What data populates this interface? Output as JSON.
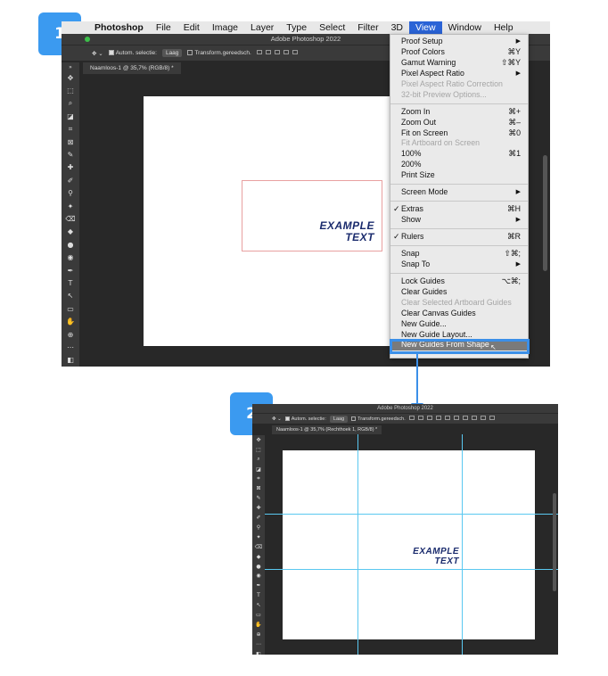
{
  "steps": {
    "one": "1",
    "two": "2"
  },
  "shot1": {
    "menubar": {
      "app": "Photoshop",
      "items": [
        "File",
        "Edit",
        "Image",
        "Layer",
        "Type",
        "Select",
        "Filter",
        "3D",
        "View",
        "Window",
        "Help"
      ],
      "active": "View"
    },
    "window_title": "Adobe Photoshop 2022",
    "options": {
      "autoselect": "Autom. selectie:",
      "layer_select": "Laag",
      "transform": "Transform.gereedsch."
    },
    "doc_tab": "Naamloos-1 @ 35,7% (RGB/8) *",
    "example_text": [
      "EXAMPLE",
      "TEXT"
    ],
    "view_menu": [
      {
        "label": "Proof Setup",
        "submenu": true
      },
      {
        "label": "Proof Colors",
        "shortcut": "⌘Y"
      },
      {
        "label": "Gamut Warning",
        "shortcut": "⇧⌘Y"
      },
      {
        "label": "Pixel Aspect Ratio",
        "submenu": true
      },
      {
        "label": "Pixel Aspect Ratio Correction",
        "disabled": true
      },
      {
        "label": "32-bit Preview Options...",
        "disabled": true
      },
      {
        "separator": true
      },
      {
        "label": "Zoom In",
        "shortcut": "⌘+"
      },
      {
        "label": "Zoom Out",
        "shortcut": "⌘–"
      },
      {
        "label": "Fit on Screen",
        "shortcut": "⌘0"
      },
      {
        "label": "Fit Artboard on Screen",
        "disabled": true
      },
      {
        "label": "100%",
        "shortcut": "⌘1"
      },
      {
        "label": "200%"
      },
      {
        "label": "Print Size"
      },
      {
        "separator": true
      },
      {
        "label": "Screen Mode",
        "submenu": true
      },
      {
        "separator": true
      },
      {
        "label": "Extras",
        "shortcut": "⌘H",
        "checked": true
      },
      {
        "label": "Show",
        "submenu": true
      },
      {
        "separator": true
      },
      {
        "label": "Rulers",
        "shortcut": "⌘R",
        "checked": true
      },
      {
        "separator": true
      },
      {
        "label": "Snap",
        "shortcut": "⇧⌘;"
      },
      {
        "label": "Snap To",
        "submenu": true
      },
      {
        "separator": true
      },
      {
        "label": "Lock Guides",
        "shortcut": "⌥⌘;"
      },
      {
        "label": "Clear Guides"
      },
      {
        "label": "Clear Selected Artboard Guides",
        "disabled": true
      },
      {
        "label": "Clear Canvas Guides"
      },
      {
        "label": "New Guide..."
      },
      {
        "label": "New Guide Layout..."
      },
      {
        "label": "New Guides From Shape",
        "highlighted": true
      }
    ]
  },
  "shot2": {
    "window_title": "Adobe Photoshop 2022",
    "options": {
      "autoselect": "Autom. selectie:",
      "layer_select": "Laag",
      "transform": "Transform.gereedsch."
    },
    "doc_tab": "Naamloos-1 @ 35,7% (Rechthoek 1, RGB/8) *",
    "example_text": [
      "EXAMPLE",
      "TEXT"
    ]
  },
  "colors": {
    "accent": "#3b9af0",
    "guide": "#5ac8f0",
    "example_text": "#1a2b6d",
    "menu_highlight": "#2a63d6"
  }
}
